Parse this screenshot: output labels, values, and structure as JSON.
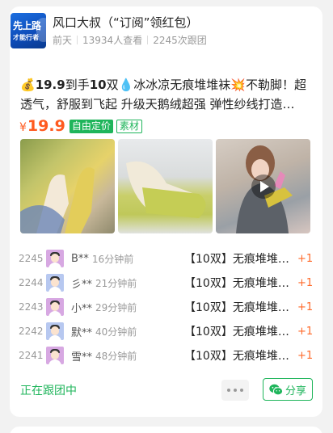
{
  "header": {
    "title": "风口大叔（“订阅”领红包）",
    "avatar_line1": "先上路",
    "avatar_line2": "才能行者",
    "date": "前天",
    "views": "13934人查看",
    "followers": "2245次跟团"
  },
  "post": {
    "bag_icon": "💰",
    "desc_bold1": "19.9",
    "desc_part1": "到手",
    "desc_bold2": "10",
    "desc_part2": "双",
    "drop_icon": "💧",
    "desc_part3": "冰冰凉无痕堆堆袜",
    "burst_icon": "💥",
    "desc_part4": "不勒脚！超透气，舒服到飞起 升级天鹅绒超强 弹性纱线打造…",
    "price_symbol": "¥",
    "price": "19.9",
    "tag_solid": "自由定价",
    "tag_outline": "素材",
    "accent_color": "#1fb55b",
    "price_color": "#ff5a1f"
  },
  "orders": [
    {
      "num": "2245",
      "name": "B**",
      "time": "16分钟前",
      "item": "【10双】无痕堆堆…",
      "qty": "+1",
      "avatar": "purple"
    },
    {
      "num": "2244",
      "name": "彡**",
      "time": "21分钟前",
      "item": "【10双】无痕堆堆…",
      "qty": "+1",
      "avatar": "blue"
    },
    {
      "num": "2243",
      "name": "小**",
      "time": "29分钟前",
      "item": "【10双】无痕堆堆…",
      "qty": "+1",
      "avatar": "purple"
    },
    {
      "num": "2242",
      "name": "默**",
      "time": "40分钟前",
      "item": "【10双】无痕堆堆…",
      "qty": "+1",
      "avatar": "blue"
    },
    {
      "num": "2241",
      "name": "雪**",
      "time": "48分钟前",
      "item": "【10双】无痕堆堆…",
      "qty": "+1",
      "avatar": "purple"
    }
  ],
  "footer": {
    "status": "正在跟团中",
    "more_icon": "more-dots-icon",
    "share_label": "分享",
    "share_icon": "wechat-icon"
  }
}
